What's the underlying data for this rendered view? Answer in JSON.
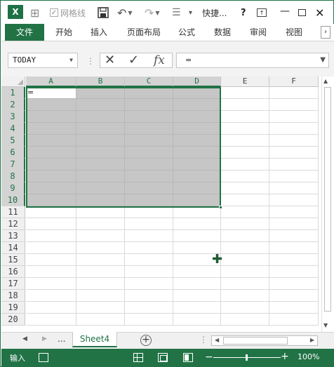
{
  "titlebar": {
    "app_logo": "X",
    "gridlines_label": "网格线",
    "title": "快捷...",
    "help": "?",
    "minimize": "—",
    "close": "✕"
  },
  "ribbon": {
    "tabs": [
      "文件",
      "开始",
      "插入",
      "页面布局",
      "公式",
      "数据",
      "审阅",
      "视图"
    ]
  },
  "formula_bar": {
    "name_box": "TODAY",
    "formula": "=",
    "fx_label": "fx"
  },
  "sheet": {
    "columns": [
      "A",
      "B",
      "C",
      "D",
      "E",
      "F"
    ],
    "rows": [
      "1",
      "2",
      "3",
      "4",
      "5",
      "6",
      "7",
      "8",
      "9",
      "10",
      "11",
      "12",
      "13",
      "14",
      "15",
      "16",
      "17",
      "18",
      "19",
      "20"
    ],
    "active_cell": "A1",
    "active_cell_value": "=",
    "selection": "A1:D10"
  },
  "sheet_tabs": {
    "more": "...",
    "active_sheet": "Sheet4",
    "add": "+",
    "dots": "⋮"
  },
  "status": {
    "mode": "输入",
    "zoom": "100%"
  },
  "colors": {
    "accent": "#217346",
    "selection_fill": "#c6c6c6"
  }
}
